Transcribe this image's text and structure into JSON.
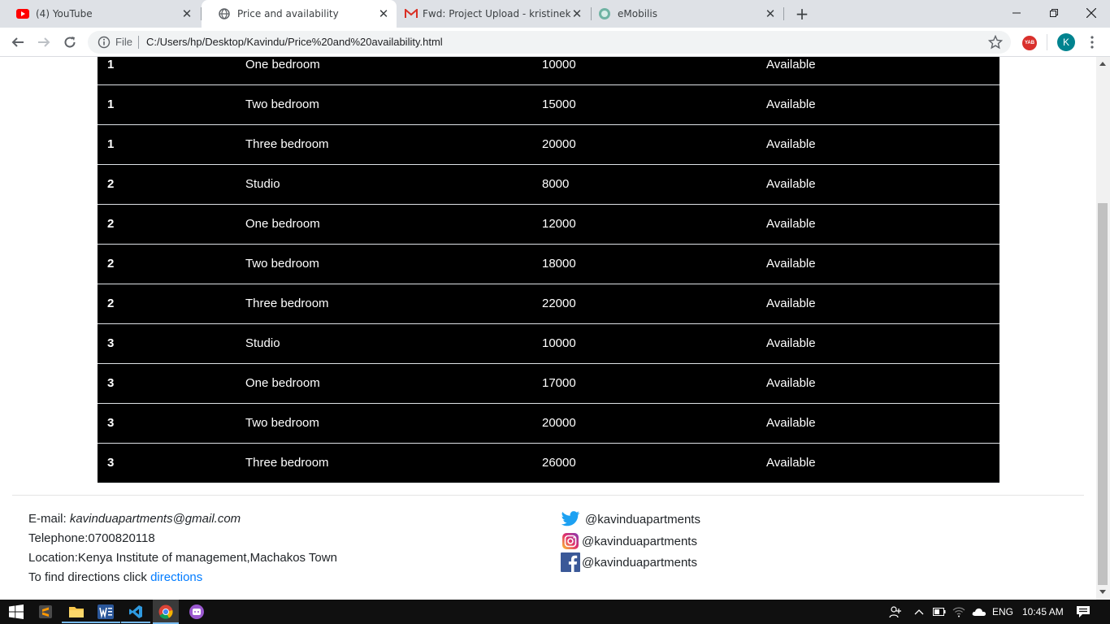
{
  "browser": {
    "tabs": [
      {
        "title": "(4) YouTube"
      },
      {
        "title": "Price and availability"
      },
      {
        "title": "Fwd: Project Upload - kristinekak"
      },
      {
        "title": "eMobilis"
      }
    ],
    "address": {
      "scheme_label": "File",
      "url": "C:/Users/hp/Desktop/Kavindu/Price%20and%20availability.html"
    },
    "profile_initial": "K",
    "extension_label": "YAB"
  },
  "table": {
    "rows": [
      {
        "floor": "1",
        "type": "One bedroom",
        "price": "10000",
        "status": "Available"
      },
      {
        "floor": "1",
        "type": "Two bedroom",
        "price": "15000",
        "status": "Available"
      },
      {
        "floor": "1",
        "type": "Three bedroom",
        "price": "20000",
        "status": "Available"
      },
      {
        "floor": "2",
        "type": "Studio",
        "price": "8000",
        "status": "Available"
      },
      {
        "floor": "2",
        "type": "One bedroom",
        "price": "12000",
        "status": "Available"
      },
      {
        "floor": "2",
        "type": "Two bedroom",
        "price": "18000",
        "status": "Available"
      },
      {
        "floor": "2",
        "type": "Three bedroom",
        "price": "22000",
        "status": "Available"
      },
      {
        "floor": "3",
        "type": "Studio",
        "price": "10000",
        "status": "Available"
      },
      {
        "floor": "3",
        "type": "One bedroom",
        "price": "17000",
        "status": "Available"
      },
      {
        "floor": "3",
        "type": "Two bedroom",
        "price": "20000",
        "status": "Available"
      },
      {
        "floor": "3",
        "type": "Three bedroom",
        "price": "26000",
        "status": "Available"
      }
    ]
  },
  "footer": {
    "email_label": "E-mail: ",
    "email": "kavinduapartments@gmail.com",
    "telephone": "Telephone:0700820118",
    "location": "Location:Kenya Institute of management,Machakos Town",
    "directions_prefix": "To find directions click ",
    "directions_link": "directions",
    "social": {
      "twitter": "@kavinduapartments",
      "instagram": "@kavinduapartments",
      "facebook": "@kavinduapartments"
    }
  },
  "taskbar": {
    "language": "ENG",
    "time": "10:45 AM"
  }
}
